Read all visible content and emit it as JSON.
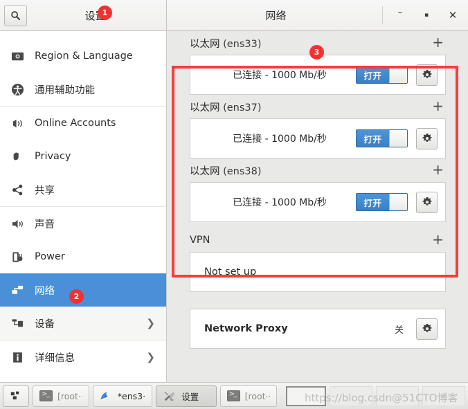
{
  "window": {
    "left_title": "设置",
    "right_title": "网络",
    "search_icon": "search-icon",
    "minimize_label": "–",
    "maximize_label": "▪",
    "close_label": "✕"
  },
  "badges": [
    {
      "id": "1",
      "label": "1",
      "color": "#f43030"
    },
    {
      "id": "2",
      "label": "2",
      "color": "#f43030"
    },
    {
      "id": "3",
      "label": "3",
      "color": "#f43030"
    }
  ],
  "sidebar": {
    "items": [
      {
        "label": "Region & Language",
        "icon": "region-language-icon",
        "selected": false,
        "chevron": false
      },
      {
        "label": "通用辅助功能",
        "icon": "accessibility-icon",
        "selected": false,
        "chevron": false
      },
      {
        "label": "Online Accounts",
        "icon": "online-accounts-icon",
        "selected": false,
        "chevron": false
      },
      {
        "label": "Privacy",
        "icon": "privacy-hand-icon",
        "selected": false,
        "chevron": false
      },
      {
        "label": "共享",
        "icon": "sharing-icon",
        "selected": false,
        "chevron": false
      },
      {
        "label": "声音",
        "icon": "sound-speaker-icon",
        "selected": false,
        "chevron": false
      },
      {
        "label": "Power",
        "icon": "power-plug-icon",
        "selected": false,
        "chevron": false
      },
      {
        "label": "网络",
        "icon": "network-icon",
        "selected": true,
        "chevron": false
      },
      {
        "label": "设备",
        "icon": "devices-icon",
        "selected": false,
        "chevron": true
      },
      {
        "label": "详细信息",
        "icon": "details-info-icon",
        "selected": false,
        "chevron": true
      }
    ],
    "chevron_glyph": "❯"
  },
  "main": {
    "sections": [
      {
        "name": "以太网",
        "iface": "(ens33)",
        "add_label": "+",
        "status": "已连接 - 1000 Mb/秒",
        "toggle_label": "打开",
        "toggle_on": true,
        "gear_icon": "gear-icon"
      },
      {
        "name": "以太网",
        "iface": "(ens37)",
        "add_label": "+",
        "status": "已连接 - 1000 Mb/秒",
        "toggle_label": "打开",
        "toggle_on": true,
        "gear_icon": "gear-icon"
      },
      {
        "name": "以太网",
        "iface": "(ens38)",
        "add_label": "+",
        "status": "已连接 - 1000 Mb/秒",
        "toggle_label": "打开",
        "toggle_on": true,
        "gear_icon": "gear-icon"
      }
    ],
    "vpn": {
      "name": "VPN",
      "add_label": "+",
      "status": "Not set up"
    },
    "proxy": {
      "label": "Network Proxy",
      "value": "关",
      "gear_icon": "gear-icon"
    }
  },
  "taskbar": {
    "launcher_icon": "show-desktop-icon",
    "buttons": [
      {
        "label": "[root···",
        "icon": "terminal-icon",
        "active": false
      },
      {
        "label": "*ens3···",
        "icon": "wireshark-icon",
        "active": false
      },
      {
        "label": "设置",
        "icon": "settings-tools-icon",
        "active": true
      },
      {
        "label": "[root···",
        "icon": "terminal-icon",
        "active": false
      }
    ]
  },
  "watermark": {
    "text": "https://blog.csdn@51CTO博客"
  }
}
